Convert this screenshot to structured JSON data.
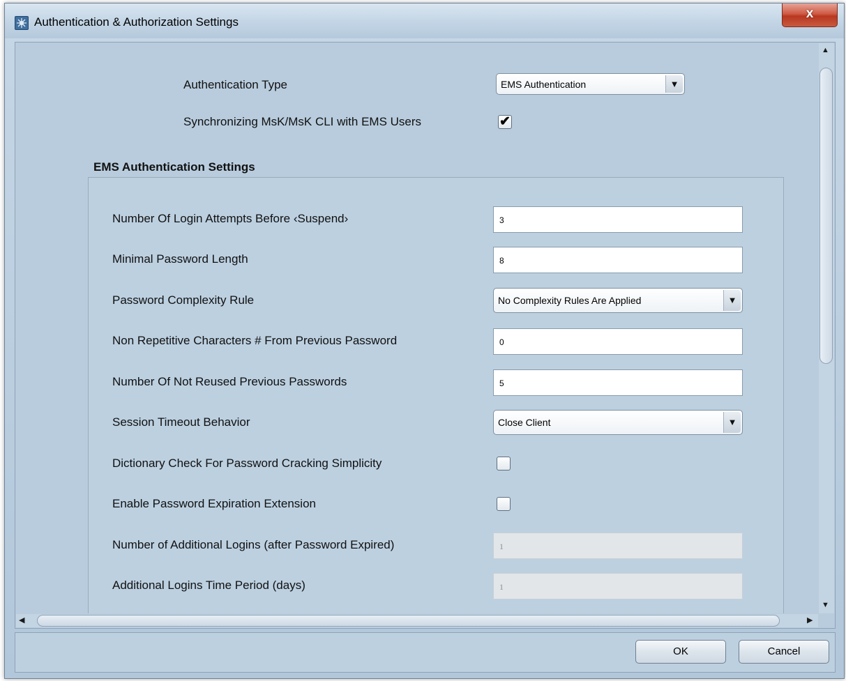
{
  "window": {
    "title": "Authentication & Authorization Settings",
    "close_label": "x"
  },
  "top": {
    "auth_type_label": "Authentication Type",
    "auth_type_value": "EMS Authentication",
    "sync_label": "Synchronizing MsK/MsK CLI with EMS Users",
    "sync_checked": true
  },
  "section": {
    "title": "EMS Authentication Settings"
  },
  "settings": {
    "login_attempts_label": "Number Of Login Attempts Before ‹Suspend›",
    "login_attempts_value": "3",
    "min_password_label": "Minimal Password Length",
    "min_password_value": "8",
    "complexity_label": "Password Complexity Rule",
    "complexity_value": "No Complexity Rules Are Applied",
    "non_repetitive_label": "Non Repetitive Characters # From Previous Password",
    "non_repetitive_value": "0",
    "not_reused_label": "Number Of Not Reused Previous Passwords",
    "not_reused_value": "5",
    "timeout_label": "Session Timeout Behavior",
    "timeout_value": "Close Client",
    "dictionary_label": "Dictionary Check For Password Cracking Simplicity",
    "dictionary_checked": false,
    "expiration_ext_label": "Enable Password Expiration Extension",
    "expiration_ext_checked": false,
    "additional_logins_label": "Number of Additional Logins (after Password Expired)",
    "additional_logins_value": "1",
    "time_period_label": "Additional Logins Time Period (days)",
    "time_period_value": "1"
  },
  "footer": {
    "ok_label": "OK",
    "cancel_label": "Cancel"
  },
  "icons": {
    "checkmark": "✔",
    "dropdown_arrow": "▼",
    "scroll_up": "▲",
    "scroll_down": "▼",
    "scroll_left": "◀",
    "scroll_right": "▶"
  }
}
